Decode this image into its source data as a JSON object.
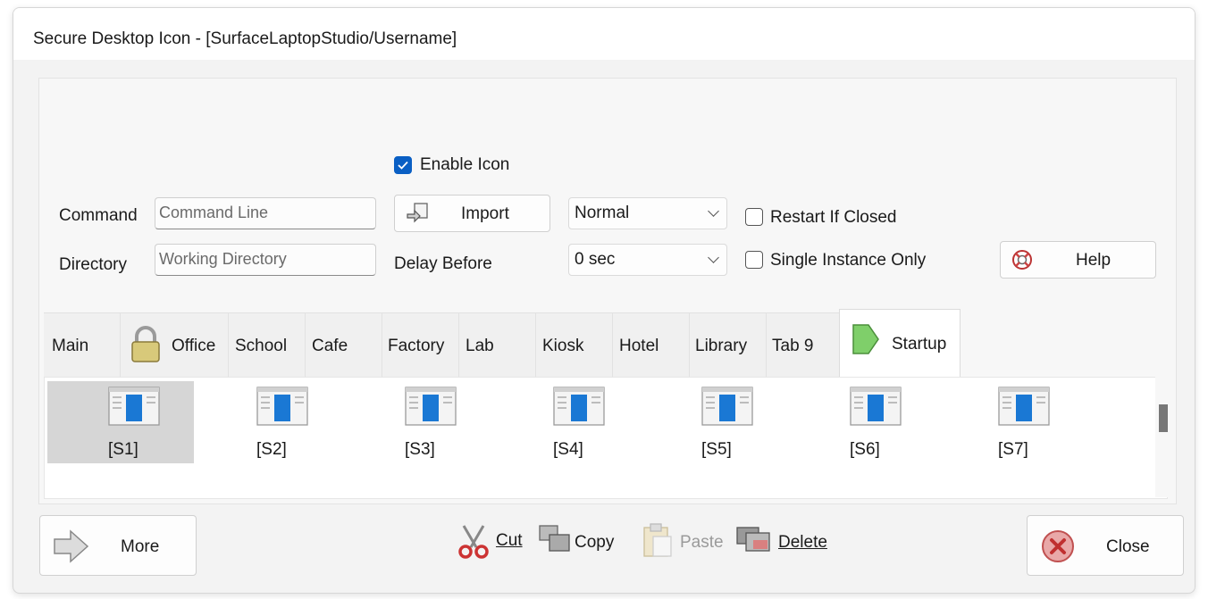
{
  "window": {
    "title": "Secure Desktop Icon - [SurfaceLaptopStudio/Username]"
  },
  "form": {
    "enable_icon_label": "Enable Icon",
    "enable_icon_checked": true,
    "command_label": "Command",
    "command_placeholder": "Command Line",
    "directory_label": "Directory",
    "directory_placeholder": "Working Directory",
    "import_label": "Import",
    "delay_label": "Delay Before",
    "window_mode_value": "Normal",
    "delay_value": "0 sec",
    "restart_label": "Restart If Closed",
    "restart_checked": false,
    "single_instance_label": "Single Instance Only",
    "single_instance_checked": false,
    "help_label": "Help"
  },
  "tabs": [
    {
      "label": "Main",
      "icon": null
    },
    {
      "label": "Office",
      "icon": "padlock-icon"
    },
    {
      "label": "School",
      "icon": null
    },
    {
      "label": "Cafe",
      "icon": null
    },
    {
      "label": "Factory",
      "icon": null
    },
    {
      "label": "Lab",
      "icon": null
    },
    {
      "label": "Kiosk",
      "icon": null
    },
    {
      "label": "Hotel",
      "icon": null
    },
    {
      "label": "Library",
      "icon": null
    },
    {
      "label": "Tab 9",
      "icon": null
    },
    {
      "label": "Startup",
      "icon": "green-arrow-icon",
      "active": true
    }
  ],
  "items": [
    {
      "label": "[S1]",
      "selected": true
    },
    {
      "label": "[S2]"
    },
    {
      "label": "[S3]"
    },
    {
      "label": "[S4]"
    },
    {
      "label": "[S5]"
    },
    {
      "label": "[S6]"
    },
    {
      "label": "[S7]"
    }
  ],
  "bottom": {
    "more_label": "More",
    "cut_label": "Cut",
    "copy_label": "Copy",
    "paste_label": "Paste",
    "paste_enabled": false,
    "delete_label": "Delete",
    "close_label": "Close"
  },
  "colors": {
    "accent": "#0a5fc4",
    "close_red": "#d9534f",
    "arrow_green": "#7fcf6a"
  }
}
